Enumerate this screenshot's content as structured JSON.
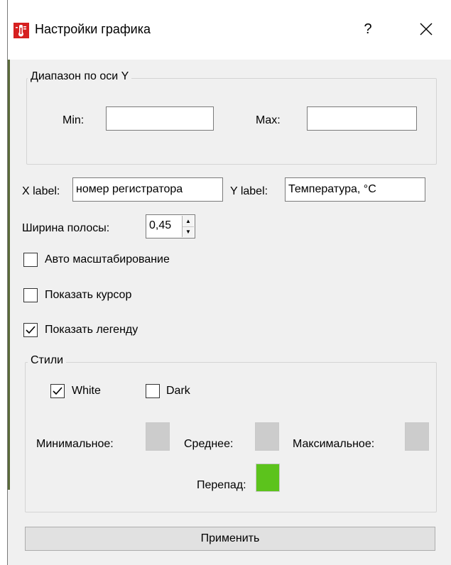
{
  "window": {
    "title": "Настройки графика",
    "help_label": "?",
    "icon": "app-thermometer-icon"
  },
  "y_range": {
    "title": "Диапазон по оси Y",
    "min_label": "Min:",
    "min_value": "",
    "max_label": "Max:",
    "max_value": ""
  },
  "labels": {
    "x_label": "X label:",
    "x_value": "номер регистратора",
    "y_label": "Y label:",
    "y_value": "Температура, °C"
  },
  "bar_width": {
    "label": "Ширина полосы:",
    "value": "0,45"
  },
  "options": {
    "auto_scale": {
      "label": "Авто масштабирование",
      "checked": false
    },
    "show_cursor": {
      "label": "Показать курсор",
      "checked": false
    },
    "show_legend": {
      "label": "Показать легенду",
      "checked": true
    }
  },
  "styles": {
    "title": "Стили",
    "white": {
      "label": "White",
      "checked": true
    },
    "dark": {
      "label": "Dark",
      "checked": false
    },
    "min_label": "Минимальное:",
    "avg_label": "Среднее:",
    "max_label": "Максимальное:",
    "diff_label": "Перепад:",
    "colors": {
      "min": "#cccccc",
      "avg": "#cccccc",
      "max": "#cccccc",
      "diff": "#5cc31c"
    }
  },
  "apply_label": "Применить"
}
